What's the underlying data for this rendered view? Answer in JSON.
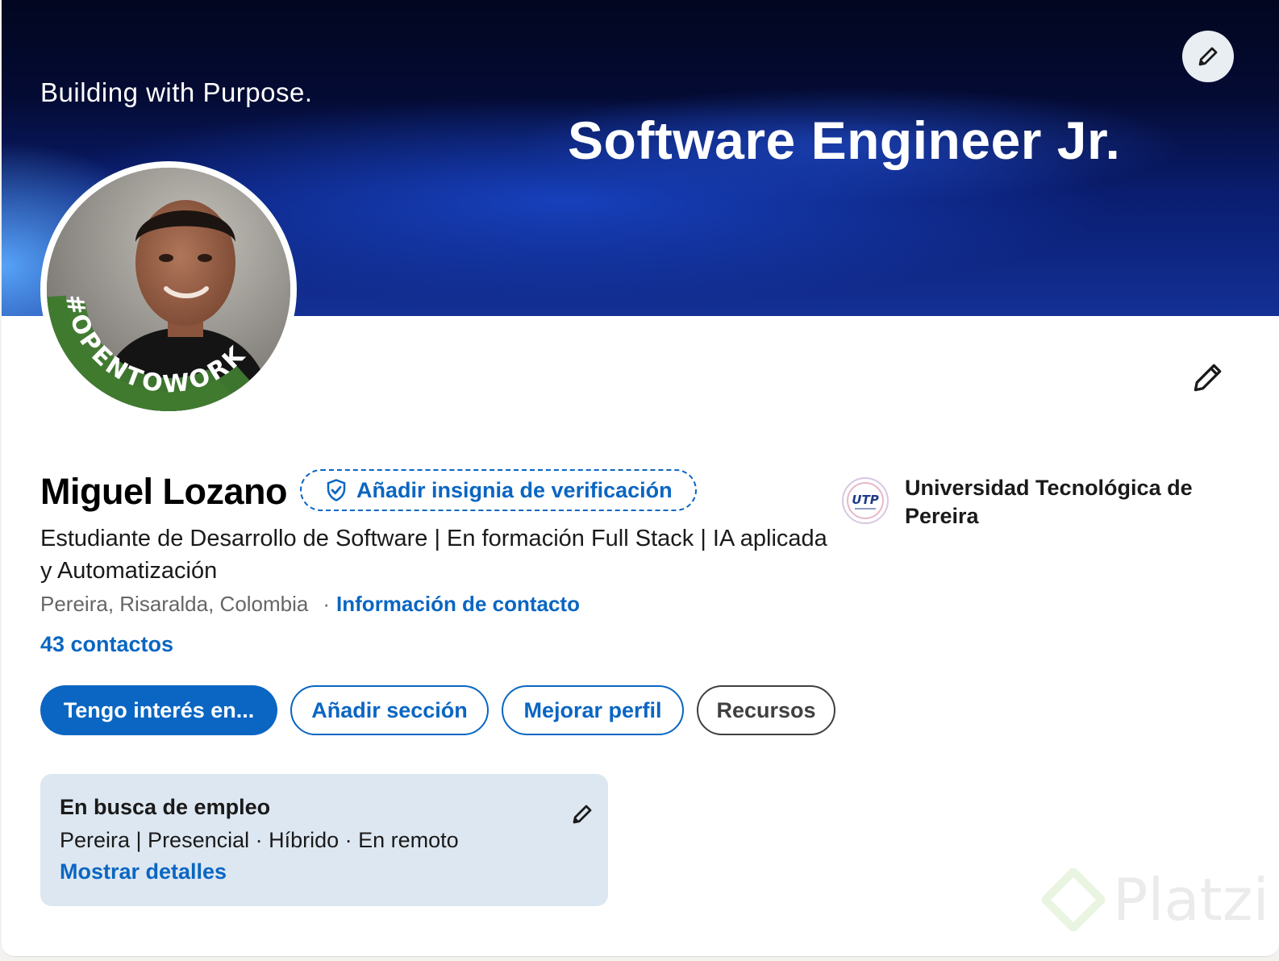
{
  "banner": {
    "tagline": "Building with Purpose.",
    "title": "Software Engineer Jr.",
    "edit_icon": "pencil-icon"
  },
  "avatar": {
    "ring_text": "#OPENTOWORK",
    "ring_color": "#3f7a2f"
  },
  "profile": {
    "name": "Miguel Lozano",
    "verify_label": "Añadir insignia de verificación",
    "headline": "Estudiante de Desarrollo de Software | En formación Full Stack | IA aplicada y Automatización",
    "location": "Pereira, Risaralda, Colombia",
    "separator": "·",
    "contact_info": "Información de contacto",
    "connections": "43 contactos",
    "edit_icon": "pencil-icon"
  },
  "actions": {
    "primary": "Tengo interés en...",
    "add_section": "Añadir sección",
    "improve_profile": "Mejorar perfil",
    "resources": "Recursos"
  },
  "education": {
    "logo_text": "UTP",
    "name": "Universidad Tecnológica de Pereira"
  },
  "open_to_work": {
    "title": "En busca de empleo",
    "details": "Pereira | Presencial · Híbrido · En remoto",
    "link": "Mostrar detalles"
  },
  "watermark": {
    "text": "Platzi"
  },
  "colors": {
    "accent": "#0a66c2",
    "card_bg": "#dde7f1",
    "banner_dark": "#040b33"
  }
}
